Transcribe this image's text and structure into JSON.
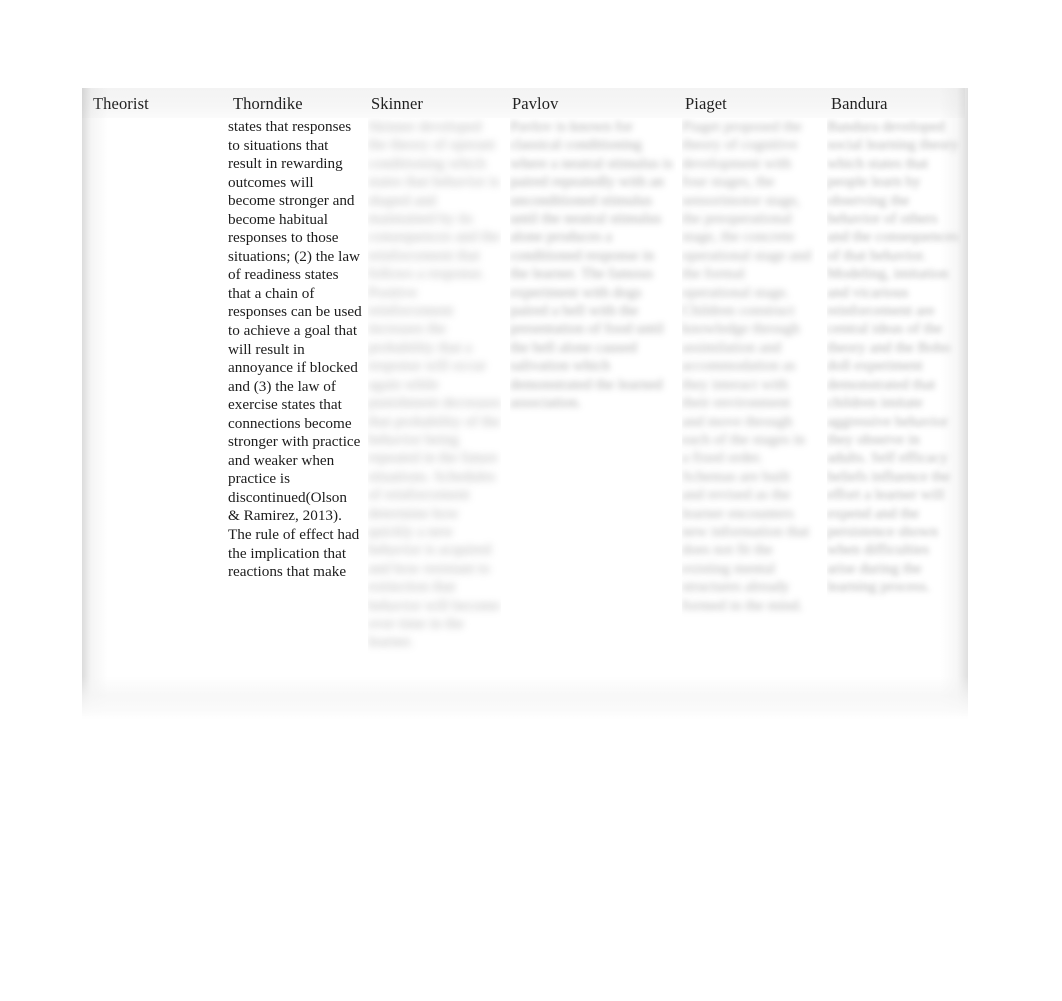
{
  "document": {
    "table": {
      "headers": [
        "Theorist",
        "Thorndike",
        "Skinner",
        "Pavlov",
        "Piaget",
        "Bandura"
      ],
      "columns": {
        "theorist": {
          "header": "Theorist",
          "body": "",
          "legible": false,
          "blurred": false
        },
        "thorndike": {
          "header": "Thorndike",
          "legible": true,
          "blurred": false,
          "body": "states that responses to situations that result in rewarding outcomes will become stronger and become habitual responses to those situations; (2) the law of readiness states that a chain of responses can be used to achieve a goal that will result in annoyance if blocked and (3) the law of exercise states that connections become stronger with practice and weaker when practice is discontinued(Olson & Ramirez, 2013). The rule of effect had the implication that reactions that make"
        },
        "skinner": {
          "header": "Skinner",
          "legible": false,
          "blurred": true,
          "body": "Skinner developed the theory of operant conditioning which states that behavior is shaped and maintained by its consequences and the reinforcement that follows a response. Positive reinforcement increases the probability that a response will occur again while punishment decreases that probability of the behavior being repeated in the future situations. Schedules of reinforcement determine how quickly a new behavior is acquired and how resistant to extinction that behavior will become over time in the learner."
        },
        "pavlov": {
          "header": "Pavlov",
          "legible": false,
          "blurred": true,
          "body": "Pavlov is known for classical conditioning where a neutral stimulus is paired repeatedly with an unconditioned stimulus until the neutral stimulus alone produces a conditioned response in the learner. The famous experiment with dogs paired a bell with the presentation of food until the bell alone caused salivation which demonstrated the learned association."
        },
        "piaget": {
          "header": "Piaget",
          "legible": false,
          "blurred": true,
          "body": "Piaget proposed the theory of cognitive development with four stages, the sensorimotor stage, the preoperational stage, the concrete operational stage and the formal operational stage. Children construct knowledge through assimilation and accommodation as they interact with their environment and move through each of the stages in a fixed order. Schemas are built and revised as the learner encounters new information that does not fit the existing mental structures already formed in the mind."
        },
        "bandura": {
          "header": "Bandura",
          "legible": false,
          "blurred": true,
          "body": "Bandura developed social learning theory which states that people learn by observing the behavior of others and the consequences of that behavior. Modeling, imitation and vicarious reinforcement are central ideas of the theory and the Bobo doll experiment demonstrated that children imitate aggressive behavior they observe in adults. Self efficacy beliefs influence the effort a learner will expend and the persistence shown when difficulties arise during the learning process."
        }
      }
    }
  }
}
